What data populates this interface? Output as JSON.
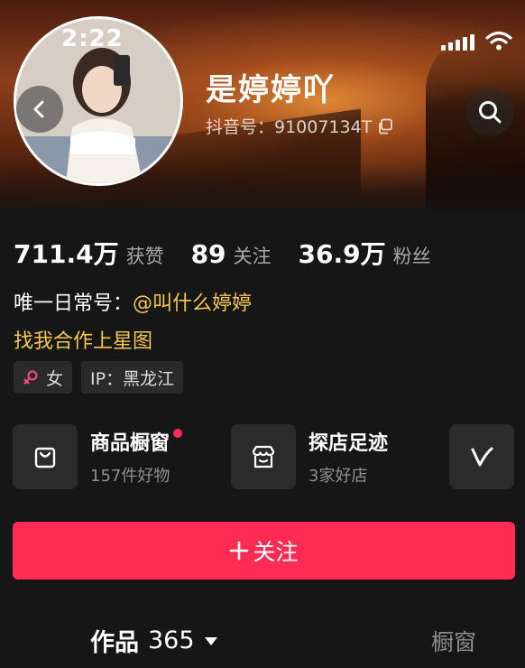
{
  "status_bar": {
    "time": "2:22"
  },
  "profile": {
    "name": "是婷婷吖",
    "douyin_id": "抖音号：91007134T"
  },
  "stats": [
    {
      "value": "711.4万",
      "label": "获赞"
    },
    {
      "value": "89",
      "label": "关注"
    },
    {
      "value": "36.9万",
      "label": "粉丝"
    }
  ],
  "bio": {
    "line1_prefix": "唯一日常号：",
    "line1_mention": "@叫什么婷婷",
    "line2": "找我合作上星图"
  },
  "tags": {
    "gender": "女",
    "ip": "IP：黑龙江"
  },
  "services": [
    {
      "title": "商品橱窗",
      "subtitle": "157件好物",
      "icon": "shopping-bag-icon",
      "has_dot": true
    },
    {
      "title": "探店足迹",
      "subtitle": "3家好店",
      "icon": "store-icon",
      "has_dot": false
    },
    {
      "title": "",
      "subtitle": "",
      "icon": "v-logo-icon",
      "has_dot": false
    }
  ],
  "follow_button": {
    "label": "关注"
  },
  "tabs": {
    "works_label": "作品",
    "works_count": "365",
    "shop_label": "橱窗"
  },
  "colors": {
    "accent": "#fe2c55",
    "highlight": "#f4c84f",
    "background": "#161616"
  }
}
